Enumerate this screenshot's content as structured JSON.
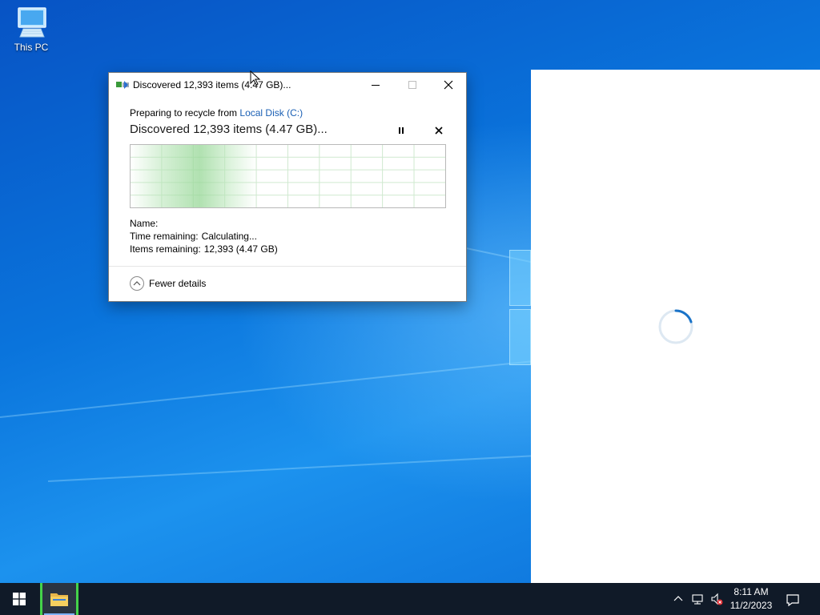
{
  "desktop": {
    "icons": [
      {
        "label": "This PC",
        "icon": "computer-icon"
      }
    ]
  },
  "dialog": {
    "title": "Discovered 12,393 items (4.47 GB)...",
    "subtitle_prefix": "Preparing to recycle from ",
    "subtitle_location": "Local Disk (C:)",
    "heading": "Discovered 12,393 items (4.47 GB)...",
    "name_label": "Name:",
    "name_value": "",
    "time_remaining_label": "Time remaining:",
    "time_remaining_value": "Calculating...",
    "items_remaining_label": "Items remaining:",
    "items_remaining_value": "12,393 (4.47 GB)",
    "details_toggle": "Fewer details",
    "accent_color": "#1a5fb4",
    "graph_color": "#9ad69a"
  },
  "loading_panel": {
    "spinner_color": "#1a73c8"
  },
  "taskbar": {
    "start_icon": "windows-logo-icon",
    "pinned": [
      {
        "name": "File Explorer",
        "icon": "folder-icon",
        "active": true
      }
    ],
    "tray_icons": [
      "chevron-up-icon",
      "network-icon",
      "volume-muted-icon"
    ],
    "clock": {
      "time": "8:11 AM",
      "date": "11/2/2023"
    },
    "notification_icon": "notification-icon"
  }
}
